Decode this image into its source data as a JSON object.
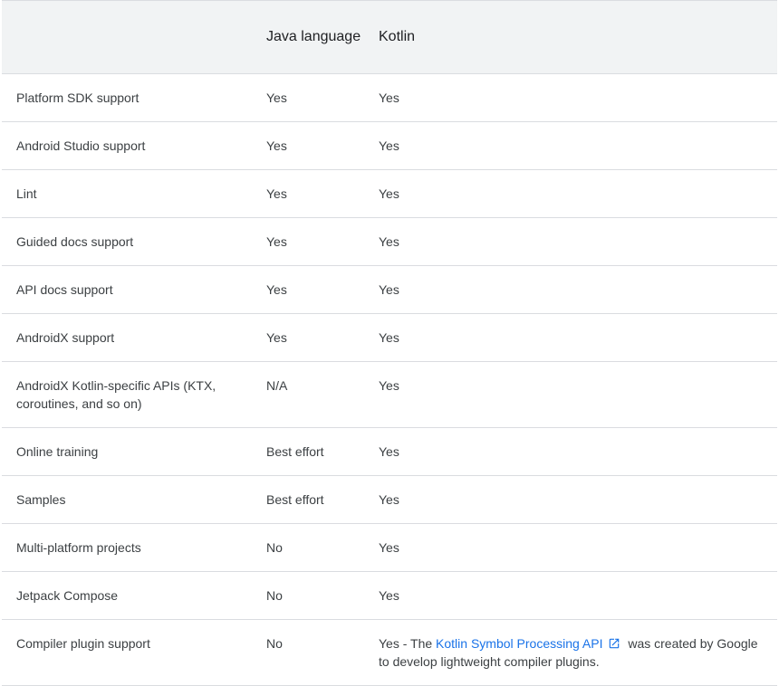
{
  "table": {
    "headers": {
      "feature": "",
      "java": "Java language",
      "kotlin": "Kotlin"
    },
    "rows": [
      {
        "feature": "Platform SDK support",
        "java": "Yes",
        "kotlin": "Yes"
      },
      {
        "feature": "Android Studio support",
        "java": "Yes",
        "kotlin": "Yes"
      },
      {
        "feature": "Lint",
        "java": "Yes",
        "kotlin": "Yes"
      },
      {
        "feature": "Guided docs support",
        "java": "Yes",
        "kotlin": "Yes"
      },
      {
        "feature": "API docs support",
        "java": "Yes",
        "kotlin": "Yes"
      },
      {
        "feature": "AndroidX support",
        "java": "Yes",
        "kotlin": "Yes"
      },
      {
        "feature": "AndroidX Kotlin-specific APIs (KTX, coroutines, and so on)",
        "java": "N/A",
        "kotlin": "Yes"
      },
      {
        "feature": "Online training",
        "java": "Best effort",
        "kotlin": "Yes"
      },
      {
        "feature": "Samples",
        "java": "Best effort",
        "kotlin": "Yes"
      },
      {
        "feature": "Multi-platform projects",
        "java": "No",
        "kotlin": "Yes"
      },
      {
        "feature": "Jetpack Compose",
        "java": "No",
        "kotlin": "Yes"
      }
    ],
    "last_row": {
      "feature": "Compiler plugin support",
      "java": "No",
      "kotlin_prefix": "Yes - The ",
      "kotlin_link": "Kotlin Symbol Processing API",
      "kotlin_link_icon": "external-link-icon",
      "kotlin_suffix": " was created by Google to develop lightweight compiler plugins."
    }
  },
  "colors": {
    "header_bg": "#f1f3f4",
    "link": "#1a73e8",
    "divider": "#dadce0",
    "text": "#3c4043"
  }
}
